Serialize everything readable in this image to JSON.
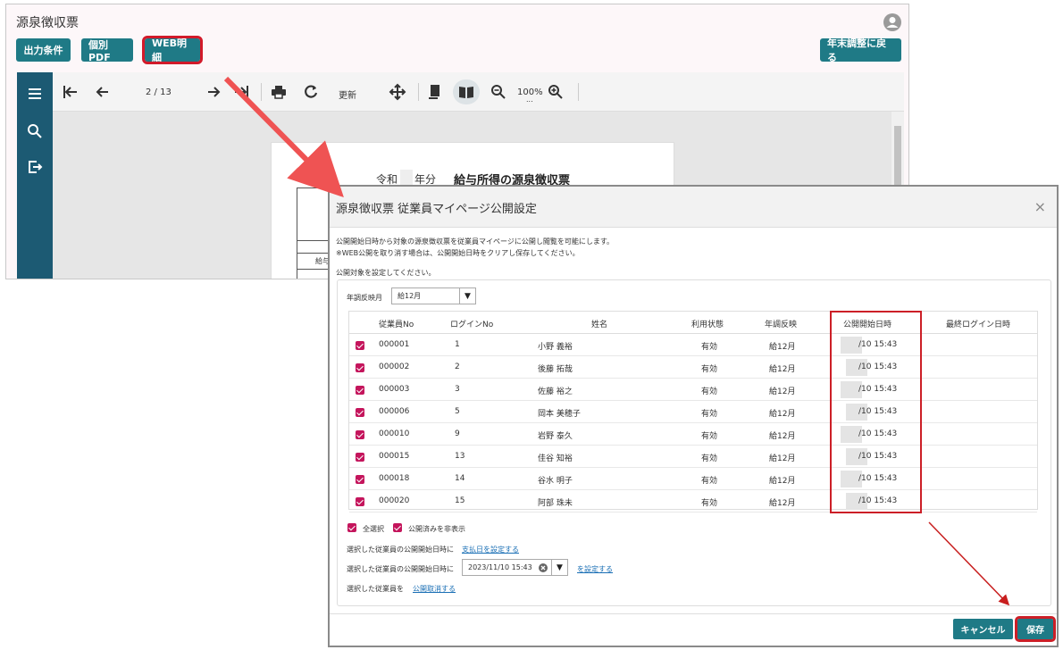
{
  "background": {
    "title": "源泉徴収票",
    "buttons": {
      "output_conditions": "出力条件",
      "individual_pdf": "個別PDF",
      "web_detail": "WEB明細",
      "back": "年末調整に戻る"
    },
    "viewer": {
      "page_indicator": "2 / 13",
      "refresh": "更新",
      "zoom": "100%",
      "zoom_sub": "...",
      "doc_era": "令和",
      "doc_year_suffix": "年分",
      "doc_title": "給与所得の源泉徴収票",
      "doc_col_label": "給与"
    }
  },
  "dialog": {
    "title": "源泉徴収票 従業員マイページ公開設定",
    "close": "×",
    "note1": "公開開始日時から対象の源泉徴収票を従業員マイページに公開し閲覧を可能にします。",
    "note2": "※WEB公開を取り消す場合は、公開開始日時をクリアし保存してください。",
    "note3": "公開対象を設定してください。",
    "filter_label": "年調反映月",
    "filter_value": "給12月",
    "columns": [
      "従業員No",
      "ログインNo",
      "姓名",
      "利用状態",
      "年調反映",
      "公開開始日時",
      "最終ログイン日時"
    ],
    "rows": [
      {
        "emp": "000001",
        "login": "1",
        "name": "小野 義裕",
        "status": "有効",
        "reflect": "給12月",
        "start": "/10 15:43",
        "last": ""
      },
      {
        "emp": "000002",
        "login": "2",
        "name": "後藤 拓哉",
        "status": "有効",
        "reflect": "給12月",
        "start": "/10 15:43",
        "last": ""
      },
      {
        "emp": "000003",
        "login": "3",
        "name": "佐藤 裕之",
        "status": "有効",
        "reflect": "給12月",
        "start": "/10 15:43",
        "last": ""
      },
      {
        "emp": "000006",
        "login": "5",
        "name": "岡本 美穂子",
        "status": "有効",
        "reflect": "給12月",
        "start": "/10 15:43",
        "last": ""
      },
      {
        "emp": "000010",
        "login": "9",
        "name": "岩野 泰久",
        "status": "有効",
        "reflect": "給12月",
        "start": "/10 15:43",
        "last": ""
      },
      {
        "emp": "000015",
        "login": "13",
        "name": "佳谷 知裕",
        "status": "有効",
        "reflect": "給12月",
        "start": "/10 15:43",
        "last": ""
      },
      {
        "emp": "000018",
        "login": "14",
        "name": "谷水 明子",
        "status": "有効",
        "reflect": "給12月",
        "start": "/10 15:43",
        "last": ""
      },
      {
        "emp": "000020",
        "login": "15",
        "name": "阿部 珠未",
        "status": "有効",
        "reflect": "給12月",
        "start": "/10 15:43",
        "last": ""
      }
    ],
    "select_all": "全選択",
    "hide_published": "公開済みを非表示",
    "action1_text": "選択した従業員の公開開始日時に",
    "action1_link": "支払日を設定する",
    "action2_text": "選択した従業員の公開開始日時に",
    "action2_value": "2023/11/10 15:43",
    "action2_link": "を設定する",
    "action3_text": "選択した従業員を",
    "action3_link": "公開取消する",
    "cancel": "キャンセル",
    "save": "保存"
  },
  "colors": {
    "accent": "#1f7a86",
    "check": "#c4155c",
    "highlight": "#cc1f27",
    "sidebar": "#1c5a73"
  }
}
